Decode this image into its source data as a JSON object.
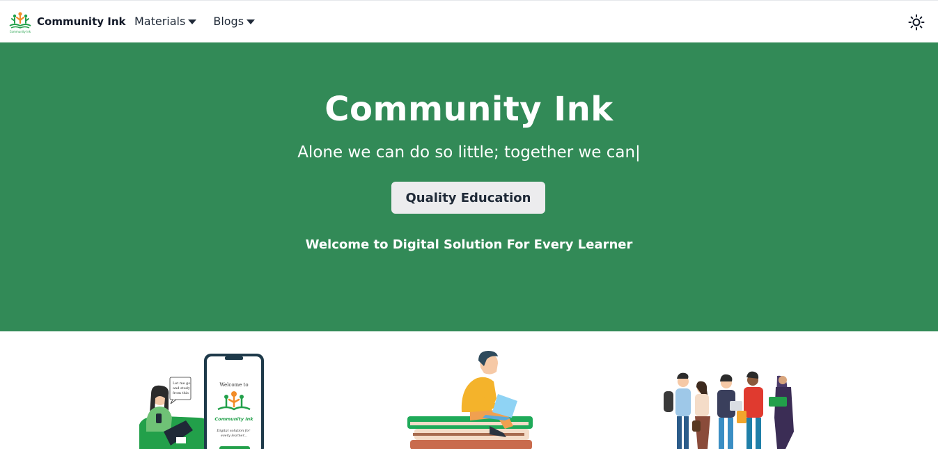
{
  "navbar": {
    "brand_name": "Community Ink",
    "logo_caption": "Community Ink",
    "menu": [
      {
        "label": "Materials"
      },
      {
        "label": "Blogs"
      }
    ],
    "theme_icon": "sun-icon"
  },
  "hero": {
    "title": "Community Ink",
    "subtitle": "Alone we can do so little; together we can|",
    "button_label": "Quality Education",
    "welcome": "Welcome to Digital Solution For Every Learner"
  },
  "illustrations": {
    "phone": {
      "speech_bubble": [
        "Let me go",
        "and study",
        "from this"
      ],
      "screen_welcome": "Welcome to",
      "screen_brand": "Community Ink",
      "screen_tagline": [
        "Digital solution for",
        "every learner..."
      ]
    }
  },
  "colors": {
    "hero_bg": "#328a57",
    "button_bg": "#ececee",
    "brand_green": "#22a04a",
    "accent_orange": "#f28c28"
  }
}
